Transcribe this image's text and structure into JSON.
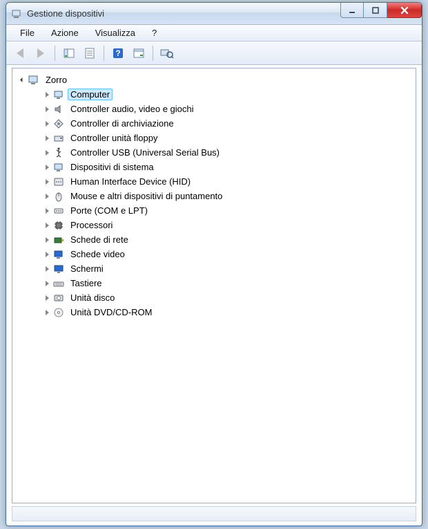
{
  "window": {
    "title": "Gestione dispositivi"
  },
  "menu": {
    "file": "File",
    "action": "Azione",
    "view": "Visualizza",
    "help": "?"
  },
  "tree": {
    "root": "Zorro",
    "items": [
      {
        "label": "Computer",
        "icon": "computer-icon",
        "selected": true
      },
      {
        "label": "Controller audio, video e giochi",
        "icon": "audio-icon"
      },
      {
        "label": "Controller di archiviazione",
        "icon": "storage-controller-icon"
      },
      {
        "label": "Controller unità floppy",
        "icon": "floppy-controller-icon"
      },
      {
        "label": "Controller USB (Universal Serial Bus)",
        "icon": "usb-icon"
      },
      {
        "label": "Dispositivi di sistema",
        "icon": "system-device-icon"
      },
      {
        "label": "Human Interface Device (HID)",
        "icon": "hid-icon"
      },
      {
        "label": "Mouse e altri dispositivi di puntamento",
        "icon": "mouse-icon"
      },
      {
        "label": "Porte (COM e LPT)",
        "icon": "port-icon"
      },
      {
        "label": "Processori",
        "icon": "processor-icon"
      },
      {
        "label": "Schede di rete",
        "icon": "network-adapter-icon"
      },
      {
        "label": "Schede video",
        "icon": "display-adapter-icon"
      },
      {
        "label": "Schermi",
        "icon": "monitor-icon"
      },
      {
        "label": "Tastiere",
        "icon": "keyboard-icon"
      },
      {
        "label": "Unità disco",
        "icon": "disk-drive-icon"
      },
      {
        "label": "Unità DVD/CD-ROM",
        "icon": "dvd-drive-icon"
      }
    ]
  }
}
